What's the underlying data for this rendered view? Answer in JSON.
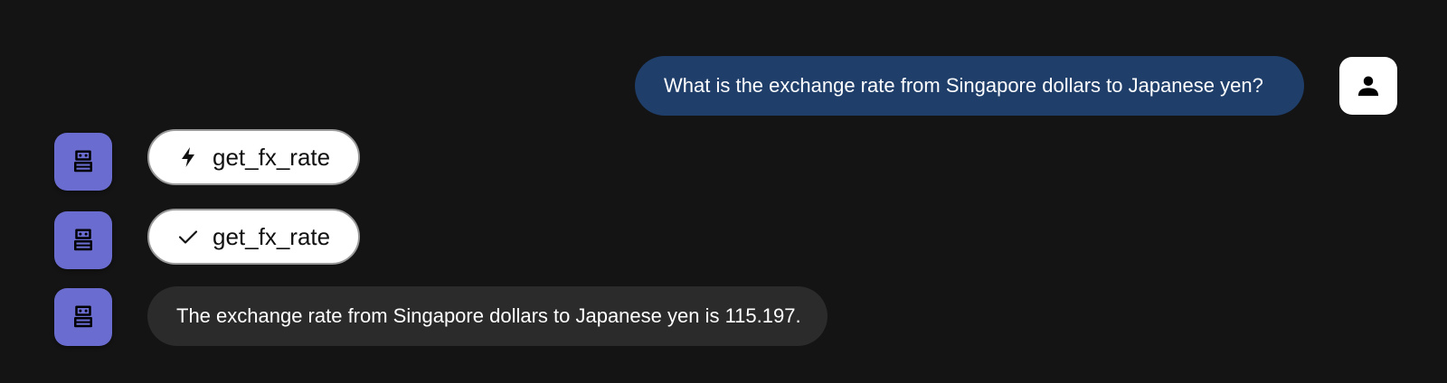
{
  "conversation": {
    "user_message": {
      "text": "What is the exchange rate from Singapore dollars to Japanese yen?",
      "avatar_icon": "person-icon",
      "bubble_color": "#1f3e6a"
    },
    "function_call": {
      "name": "get_fx_rate",
      "icon": "lightning-bolt-icon"
    },
    "function_response": {
      "name": "get_fx_rate",
      "icon": "checkmark-icon"
    },
    "bot_message": {
      "text": "The exchange rate from Singapore dollars to Japanese yen is 115.197.",
      "bubble_color": "#2b2b2b"
    },
    "bot_avatar": {
      "icon": "robot-icon",
      "color": "#6a6ccf"
    }
  }
}
